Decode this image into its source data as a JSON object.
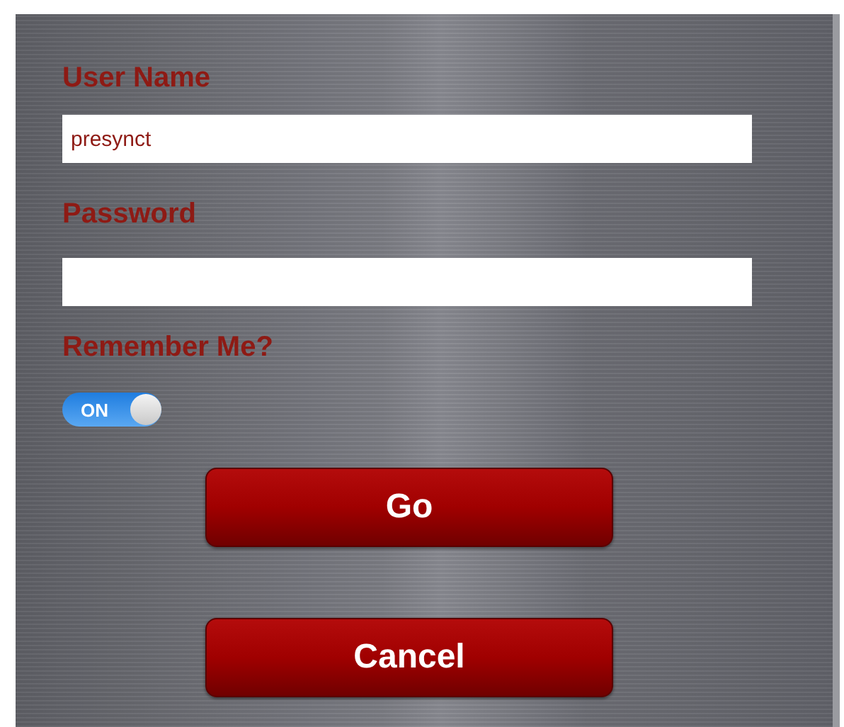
{
  "username": {
    "label": "User Name",
    "value": "presynct"
  },
  "password": {
    "label": "Password"
  },
  "remember": {
    "label": "Remember Me?",
    "on": true,
    "on_text": "ON"
  },
  "buttons": [
    "Go",
    "Cancel"
  ]
}
